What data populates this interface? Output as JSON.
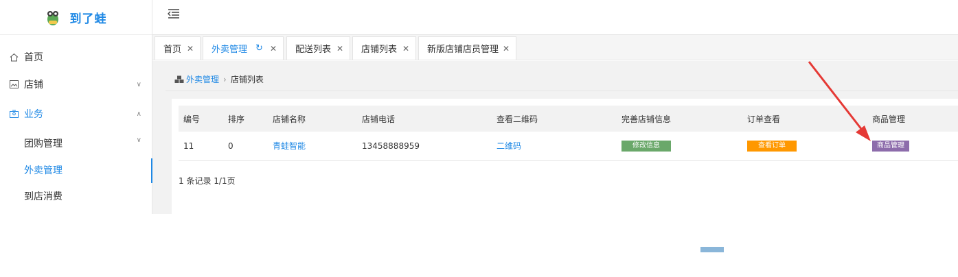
{
  "app": {
    "title": "到了蛙"
  },
  "sidebar": {
    "items": [
      {
        "label": "首页",
        "icon": "home-icon"
      },
      {
        "label": "店铺",
        "icon": "image-icon"
      },
      {
        "label": "业务",
        "icon": "user-card-icon"
      }
    ],
    "submenu": [
      {
        "label": "团购管理"
      },
      {
        "label": "外卖管理"
      },
      {
        "label": "到店消费"
      }
    ]
  },
  "tabs": [
    {
      "label": "首页"
    },
    {
      "label": "外卖管理"
    },
    {
      "label": "配送列表"
    },
    {
      "label": "店铺列表"
    },
    {
      "label": "新版店铺店员管理"
    }
  ],
  "breadcrumb": {
    "parent": "外卖管理",
    "current": "店铺列表"
  },
  "table": {
    "headers": [
      "编号",
      "排序",
      "店铺名称",
      "店铺电话",
      "查看二维码",
      "完善店铺信息",
      "订单查看",
      "商品管理"
    ],
    "rows": [
      {
        "id": "11",
        "sort": "0",
        "name": "青蛙智能",
        "phone": "13458888959",
        "qr": "二维码",
        "edit": "修改信息",
        "orders": "查看订单",
        "goods": "商品管理"
      }
    ]
  },
  "pagination": {
    "summary": "1 条记录 1/1页"
  },
  "colors": {
    "accent": "#1e88e5",
    "green": "#6aa86a",
    "orange": "#ff9800",
    "purple": "#8d6cab",
    "arrow": "#e53935"
  }
}
